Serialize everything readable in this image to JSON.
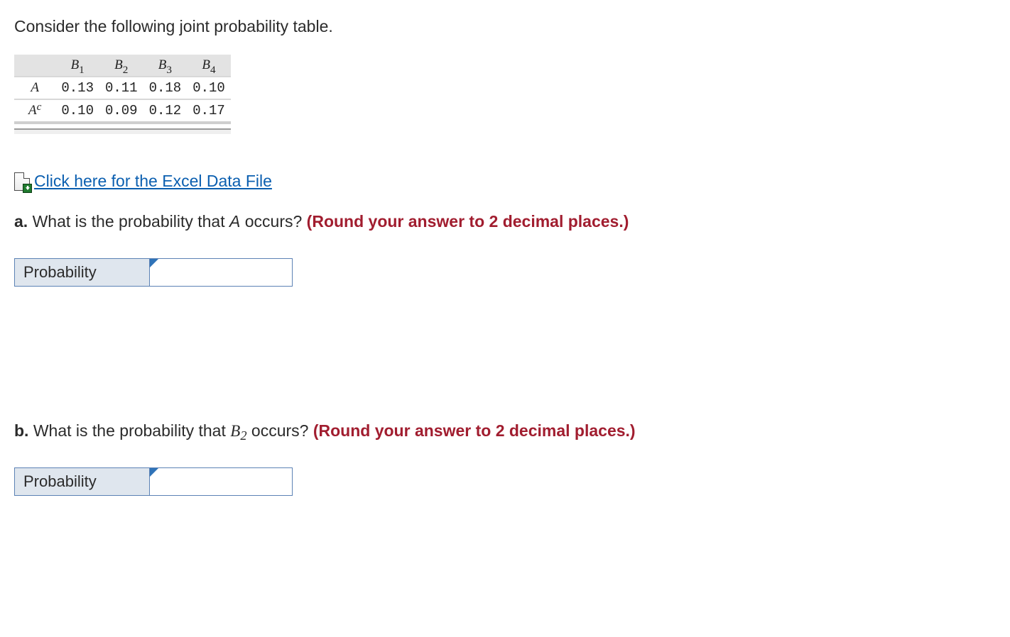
{
  "intro": "Consider the following joint probability table.",
  "table": {
    "col_labels": [
      {
        "base": "B",
        "sub": "1"
      },
      {
        "base": "B",
        "sub": "2"
      },
      {
        "base": "B",
        "sub": "3"
      },
      {
        "base": "B",
        "sub": "4"
      }
    ],
    "rows": [
      {
        "label_base": "A",
        "label_sup": "",
        "cells": [
          "0.13",
          "0.11",
          "0.18",
          "0.10"
        ]
      },
      {
        "label_base": "A",
        "label_sup": "c",
        "cells": [
          "0.10",
          "0.09",
          "0.12",
          "0.17"
        ]
      }
    ]
  },
  "excel_link_text": "Click here for the Excel Data File",
  "questions": {
    "a": {
      "label": "a.",
      "text_before": " What is the probability that ",
      "var_html": "A",
      "text_after": " occurs? ",
      "hint": "(Round your answer to 2 decimal places.)",
      "answer_label": "Probability",
      "answer_value": ""
    },
    "b": {
      "label": "b.",
      "text_before": " What is the probability that ",
      "var_base": "B",
      "var_sub": "2",
      "text_after": "  occurs? ",
      "hint": "(Round your answer to 2 decimal places.)",
      "answer_label": "Probability",
      "answer_value": ""
    }
  },
  "chart_data": {
    "type": "table",
    "title": "Joint probability table",
    "columns": [
      "",
      "B1",
      "B2",
      "B3",
      "B4"
    ],
    "rows": [
      {
        "row": "A",
        "values": [
          0.13,
          0.11,
          0.18,
          0.1
        ]
      },
      {
        "row": "A^c",
        "values": [
          0.1,
          0.09,
          0.12,
          0.17
        ]
      }
    ]
  }
}
